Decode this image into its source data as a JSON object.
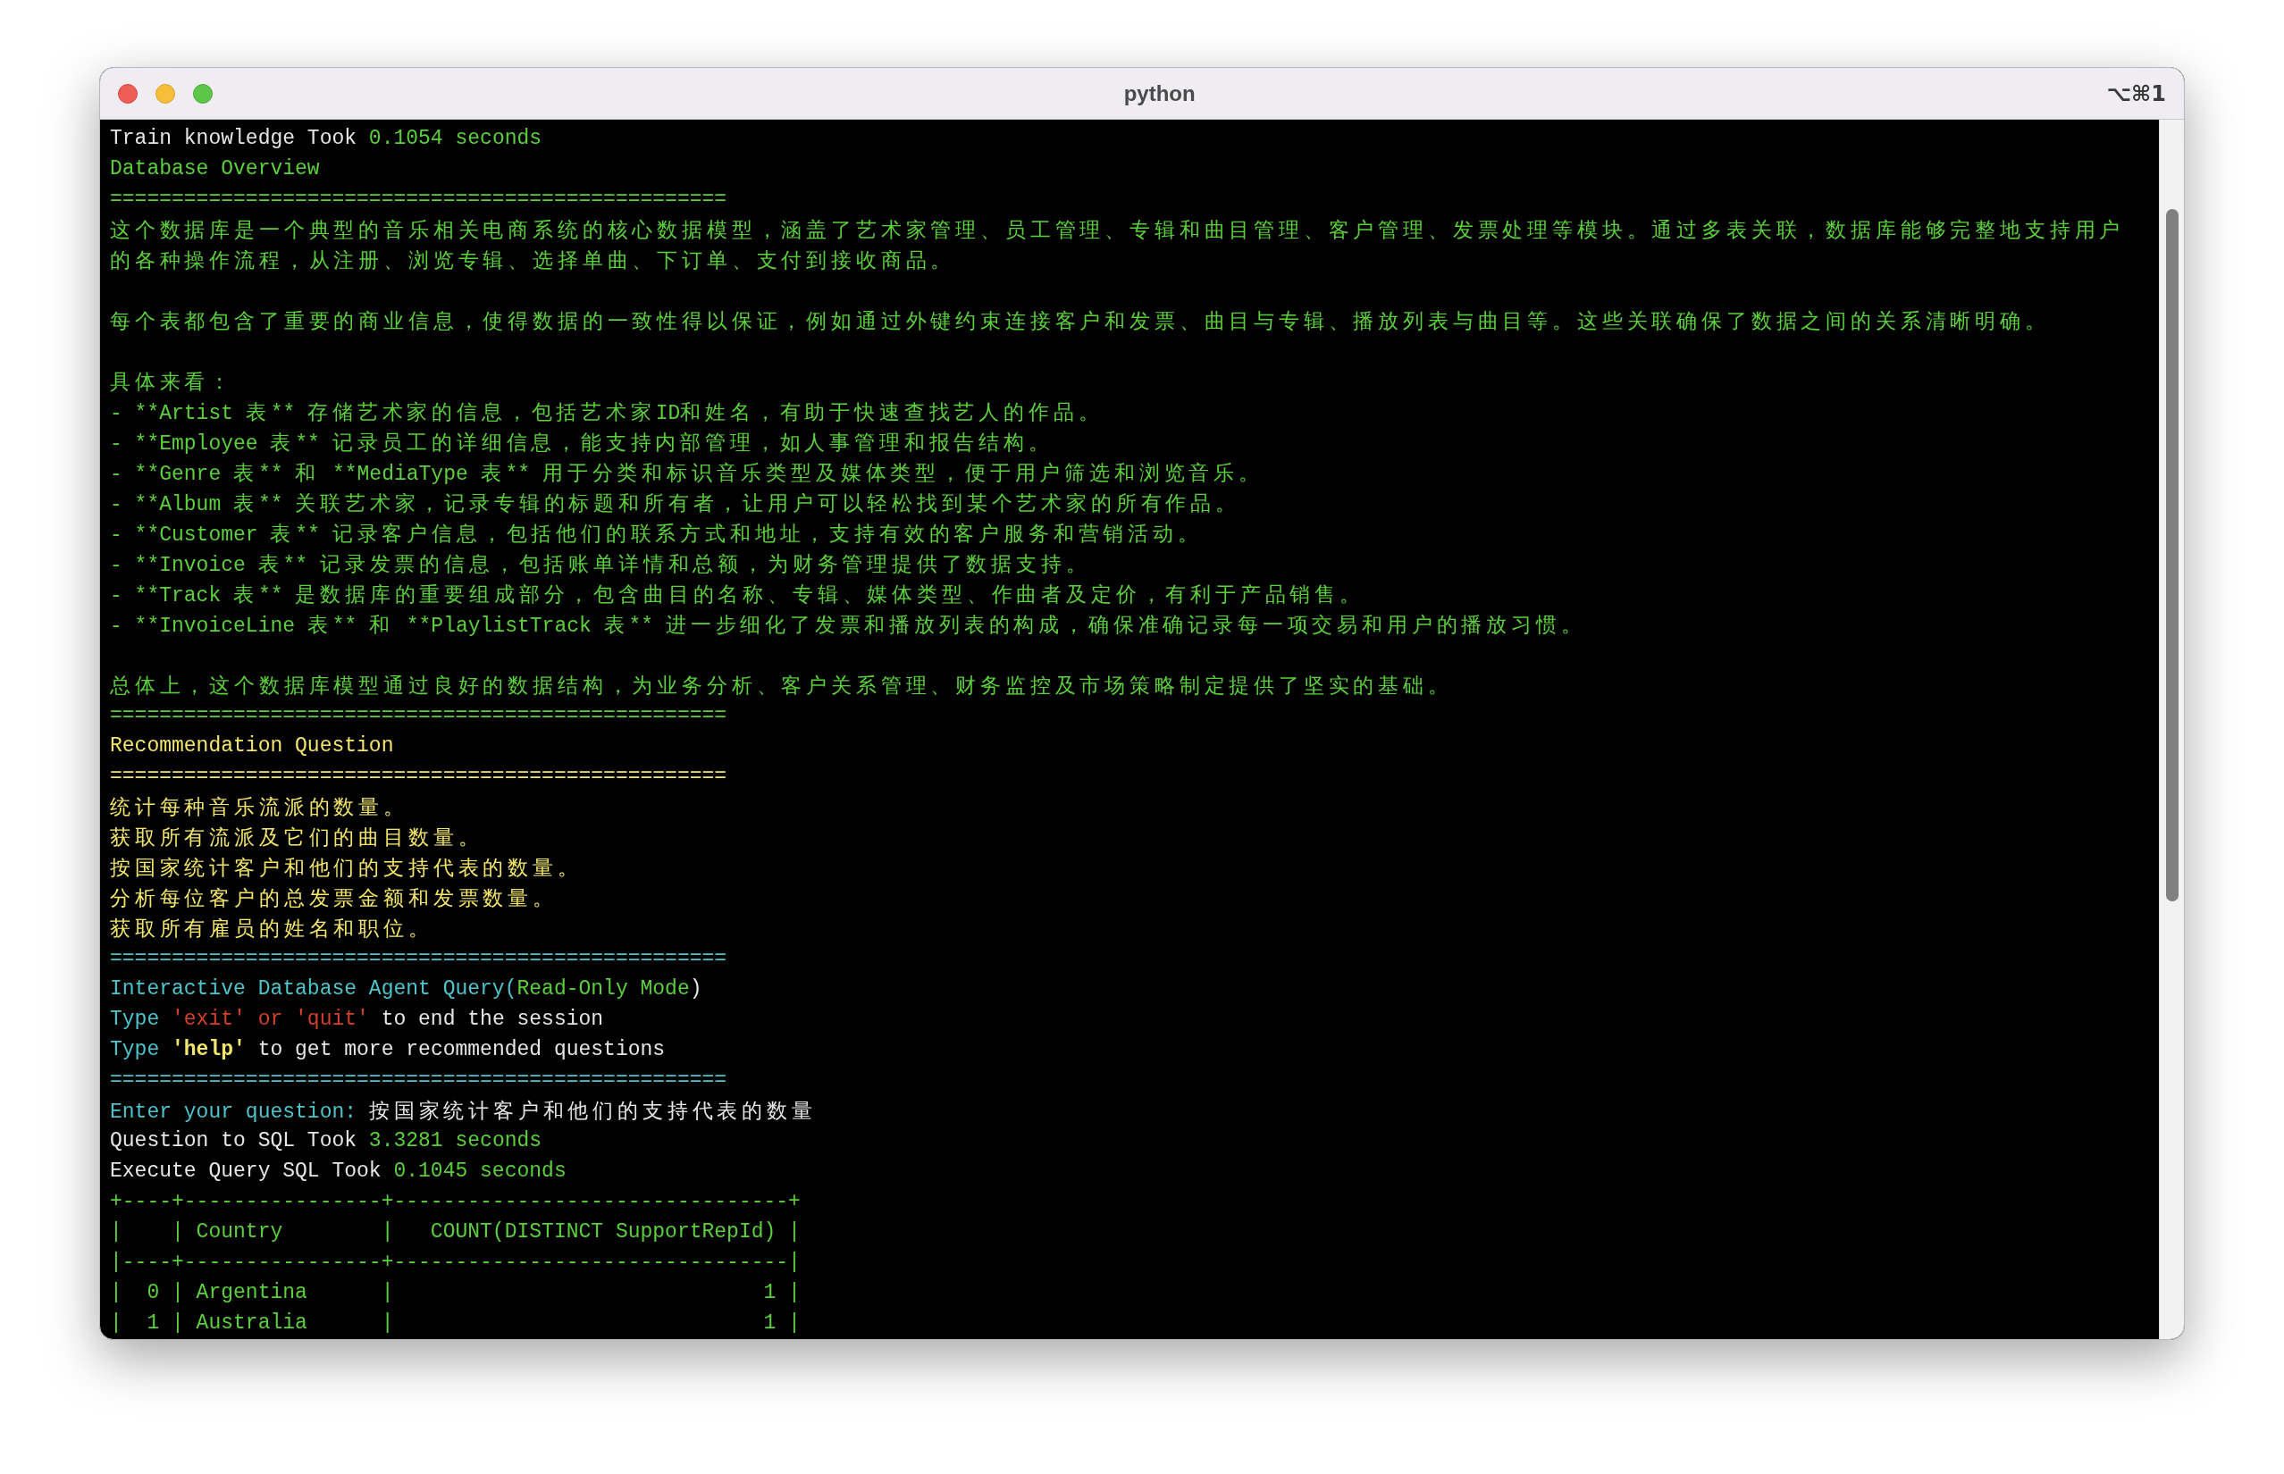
{
  "window": {
    "title": "python",
    "shortcut": "⌥⌘1"
  },
  "lines": [
    {
      "kind": "text",
      "segments": [
        {
          "color": "#e6e6e6",
          "text": "Train knowledge Took "
        },
        {
          "color": "#5ccf3c",
          "text": "0.1054 seconds"
        }
      ]
    },
    {
      "kind": "text",
      "segments": [
        {
          "color": "#5ccf3c",
          "text": "Database Overview"
        }
      ]
    },
    {
      "kind": "text",
      "segments": [
        {
          "color": "#5ccf3c",
          "text": "=================================================="
        }
      ]
    },
    {
      "kind": "text",
      "segments": [
        {
          "color": "#5ccf3c",
          "text": "这个数据库是一个典型的音乐相关电商系统的核心数据模型，涵盖了艺术家管理、员工管理、专辑和曲目管理、客户管理、发票处理等模块。通过多表关联，数据库能够完整地支持用户"
        }
      ]
    },
    {
      "kind": "text",
      "segments": [
        {
          "color": "#5ccf3c",
          "text": "的各种操作流程，从注册、浏览专辑、选择单曲、下订单、支付到接收商品。"
        }
      ]
    },
    {
      "kind": "blank"
    },
    {
      "kind": "text",
      "segments": [
        {
          "color": "#5ccf3c",
          "text": "每个表都包含了重要的商业信息，使得数据的一致性得以保证，例如通过外键约束连接客户和发票、曲目与专辑、播放列表与曲目等。这些关联确保了数据之间的关系清晰明确。"
        }
      ]
    },
    {
      "kind": "blank"
    },
    {
      "kind": "text",
      "segments": [
        {
          "color": "#5ccf3c",
          "text": "具体来看："
        }
      ]
    },
    {
      "kind": "text",
      "segments": [
        {
          "color": "#5ccf3c",
          "text": "- **Artist 表** 存储艺术家的信息，包括艺术家ID和姓名，有助于快速查找艺人的作品。"
        }
      ]
    },
    {
      "kind": "text",
      "segments": [
        {
          "color": "#5ccf3c",
          "text": "- **Employee 表** 记录员工的详细信息，能支持内部管理，如人事管理和报告结构。"
        }
      ]
    },
    {
      "kind": "text",
      "segments": [
        {
          "color": "#5ccf3c",
          "text": "- **Genre 表** 和 **MediaType 表** 用于分类和标识音乐类型及媒体类型，便于用户筛选和浏览音乐。"
        }
      ]
    },
    {
      "kind": "text",
      "segments": [
        {
          "color": "#5ccf3c",
          "text": "- **Album 表** 关联艺术家，记录专辑的标题和所有者，让用户可以轻松找到某个艺术家的所有作品。"
        }
      ]
    },
    {
      "kind": "text",
      "segments": [
        {
          "color": "#5ccf3c",
          "text": "- **Customer 表** 记录客户信息，包括他们的联系方式和地址，支持有效的客户服务和营销活动。"
        }
      ]
    },
    {
      "kind": "text",
      "segments": [
        {
          "color": "#5ccf3c",
          "text": "- **Invoice 表** 记录发票的信息，包括账单详情和总额，为财务管理提供了数据支持。"
        }
      ]
    },
    {
      "kind": "text",
      "segments": [
        {
          "color": "#5ccf3c",
          "text": "- **Track 表** 是数据库的重要组成部分，包含曲目的名称、专辑、媒体类型、作曲者及定价，有利于产品销售。"
        }
      ]
    },
    {
      "kind": "text",
      "segments": [
        {
          "color": "#5ccf3c",
          "text": "- **InvoiceLine 表** 和 **PlaylistTrack 表** 进一步细化了发票和播放列表的构成，确保准确记录每一项交易和用户的播放习惯。"
        }
      ]
    },
    {
      "kind": "blank"
    },
    {
      "kind": "text",
      "segments": [
        {
          "color": "#5ccf3c",
          "text": "总体上，这个数据库模型通过良好的数据结构，为业务分析、客户关系管理、财务监控及市场策略制定提供了坚实的基础。"
        }
      ]
    },
    {
      "kind": "text",
      "segments": [
        {
          "color": "#5ccf3c",
          "text": "=================================================="
        }
      ]
    },
    {
      "kind": "text",
      "segments": [
        {
          "color": "#f3e66b",
          "text": "Recommendation Question"
        }
      ]
    },
    {
      "kind": "text",
      "segments": [
        {
          "color": "#f3e66b",
          "text": "=================================================="
        }
      ]
    },
    {
      "kind": "text",
      "segments": [
        {
          "color": "#f3e66b",
          "text": "统计每种音乐流派的数量。"
        }
      ]
    },
    {
      "kind": "text",
      "segments": [
        {
          "color": "#f3e66b",
          "text": "获取所有流派及它们的曲目数量。"
        }
      ]
    },
    {
      "kind": "text",
      "segments": [
        {
          "color": "#f3e66b",
          "text": "按国家统计客户和他们的支持代表的数量。"
        }
      ]
    },
    {
      "kind": "text",
      "segments": [
        {
          "color": "#f3e66b",
          "text": "分析每位客户的总发票金额和发票数量。"
        }
      ]
    },
    {
      "kind": "text",
      "segments": [
        {
          "color": "#f3e66b",
          "text": "获取所有雇员的姓名和职位。"
        }
      ]
    },
    {
      "kind": "text",
      "segments": [
        {
          "color": "#4ec4cb",
          "text": "=================================================="
        }
      ]
    },
    {
      "kind": "text",
      "segments": [
        {
          "color": "#4ec4cb",
          "text": "Interactive Database Agent Query("
        },
        {
          "color": "#5ccf3c",
          "text": "Read-Only Mode"
        },
        {
          "color": "#e6e6e6",
          "text": ")"
        }
      ]
    },
    {
      "kind": "text",
      "segments": [
        {
          "color": "#4ec4cb",
          "text": "Type "
        },
        {
          "color": "#d3402c",
          "text": "'exit' or 'quit'"
        },
        {
          "color": "#e6e6e6",
          "text": " to end the session"
        }
      ]
    },
    {
      "kind": "text",
      "segments": [
        {
          "color": "#4ec4cb",
          "text": "Type ",
          "bold": false
        },
        {
          "color": "#f3e66b",
          "text": "'help'",
          "bold": true
        },
        {
          "color": "#e6e6e6",
          "text": " to get more recommended questions",
          "bold": false
        }
      ]
    },
    {
      "kind": "text",
      "segments": [
        {
          "color": "#4ec4cb",
          "text": "=================================================="
        }
      ]
    },
    {
      "kind": "text",
      "segments": [
        {
          "color": "#4ec4cb",
          "text": "Enter your question: "
        },
        {
          "color": "#e6e6e6",
          "text": "按国家统计客户和他们的支持代表的数量"
        }
      ]
    },
    {
      "kind": "text",
      "segments": [
        {
          "color": "#e6e6e6",
          "text": "Question to SQL Took "
        },
        {
          "color": "#5ccf3c",
          "text": "3.3281 seconds"
        }
      ]
    },
    {
      "kind": "text",
      "segments": [
        {
          "color": "#e6e6e6",
          "text": "Execute Query SQL Took "
        },
        {
          "color": "#5ccf3c",
          "text": "0.1045 seconds"
        }
      ]
    },
    {
      "kind": "text",
      "segments": [
        {
          "color": "#5ccf3c",
          "text": "+----+----------------+--------------------------------+"
        }
      ]
    },
    {
      "kind": "text",
      "segments": [
        {
          "color": "#5ccf3c",
          "text": "|    | Country        |   COUNT(DISTINCT SupportRepId) |"
        }
      ]
    },
    {
      "kind": "text",
      "segments": [
        {
          "color": "#5ccf3c",
          "text": "|----+----------------+--------------------------------|"
        }
      ]
    },
    {
      "kind": "text",
      "segments": [
        {
          "color": "#5ccf3c",
          "text": "|  0 | Argentina      |                              1 |"
        }
      ]
    },
    {
      "kind": "text",
      "segments": [
        {
          "color": "#5ccf3c",
          "text": "|  1 | Australia      |                              1 |"
        }
      ]
    }
  ]
}
